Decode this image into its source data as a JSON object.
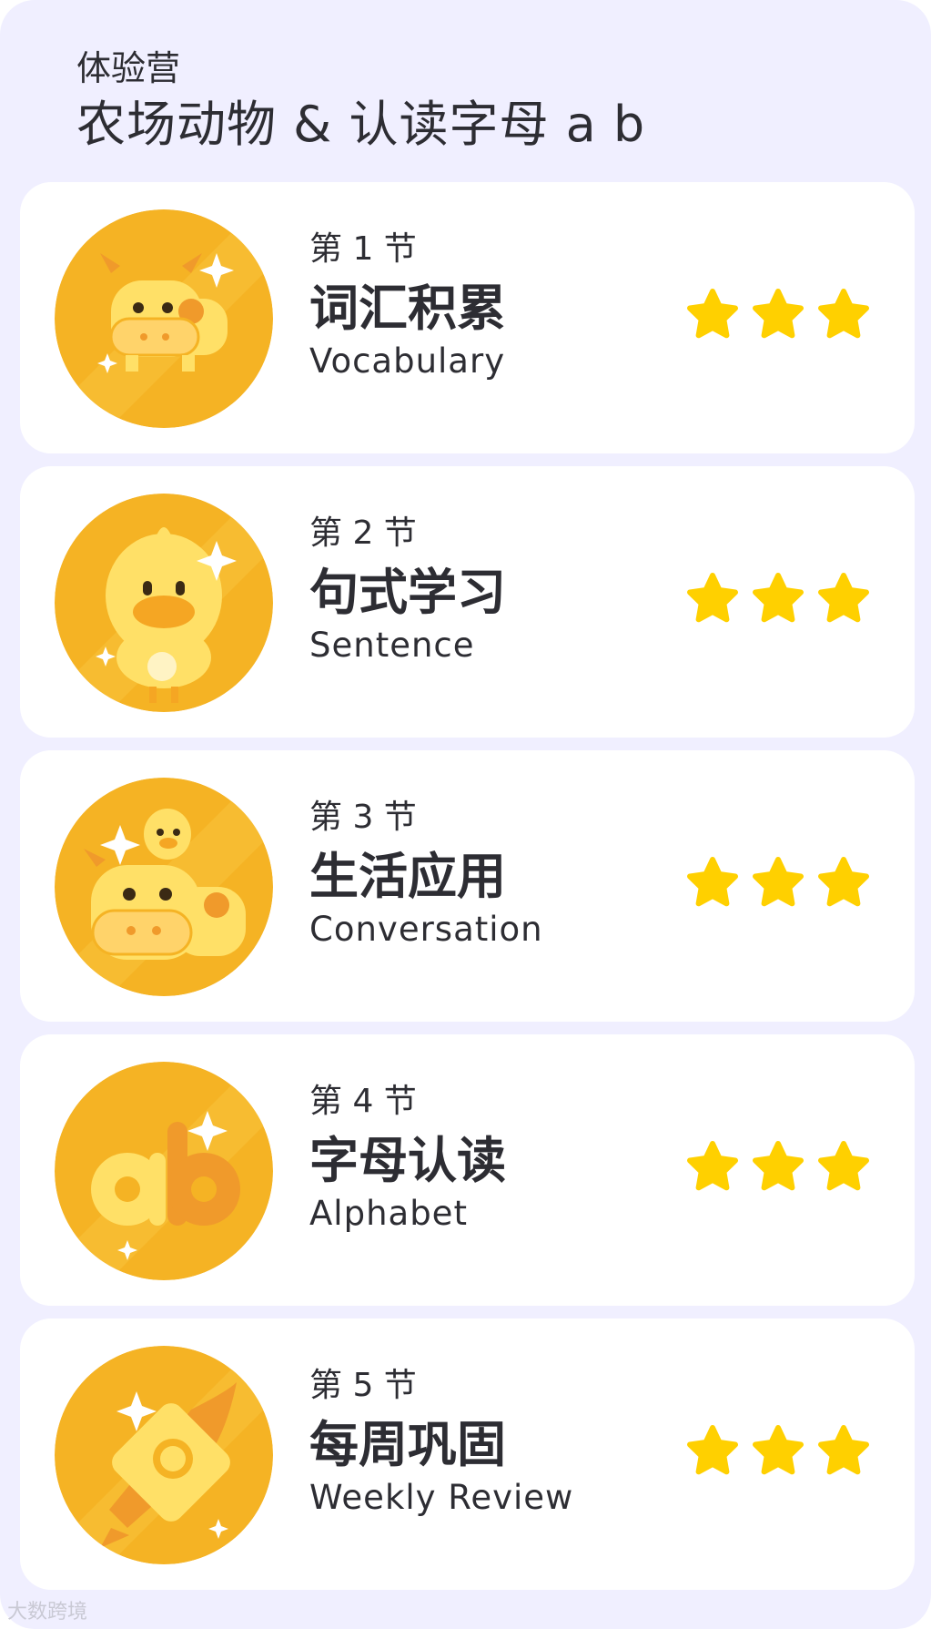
{
  "header": {
    "camp_label": "体验营",
    "course_title": "农场动物 & 认读字母 a b"
  },
  "lessons": [
    {
      "number_label": "第 1 节",
      "title_cn": "词汇积累",
      "title_en": "Vocabulary",
      "badge_icon": "cow-badge-icon",
      "stars_earned": 3,
      "stars_total": 3
    },
    {
      "number_label": "第 2 节",
      "title_cn": "句式学习",
      "title_en": "Sentence",
      "badge_icon": "chick-badge-icon",
      "stars_earned": 3,
      "stars_total": 3
    },
    {
      "number_label": "第 3 节",
      "title_cn": "生活应用",
      "title_en": "Conversation",
      "badge_icon": "cow-and-chick-badge-icon",
      "stars_earned": 3,
      "stars_total": 3
    },
    {
      "number_label": "第 4 节",
      "title_cn": "字母认读",
      "title_en": "Alphabet",
      "badge_icon": "letters-ab-badge-icon",
      "stars_earned": 3,
      "stars_total": 3
    },
    {
      "number_label": "第 5 节",
      "title_cn": "每周巩固",
      "title_en": "Weekly Review",
      "badge_icon": "rocket-badge-icon",
      "stars_earned": 3,
      "stars_total": 3
    }
  ],
  "watermark": "大数跨境",
  "colors": {
    "background": "#f0efff",
    "card": "#ffffff",
    "badge_outer": "#f5b324",
    "badge_inner": "#ffd148",
    "star": "#ffd000",
    "text": "#2d2d33"
  }
}
